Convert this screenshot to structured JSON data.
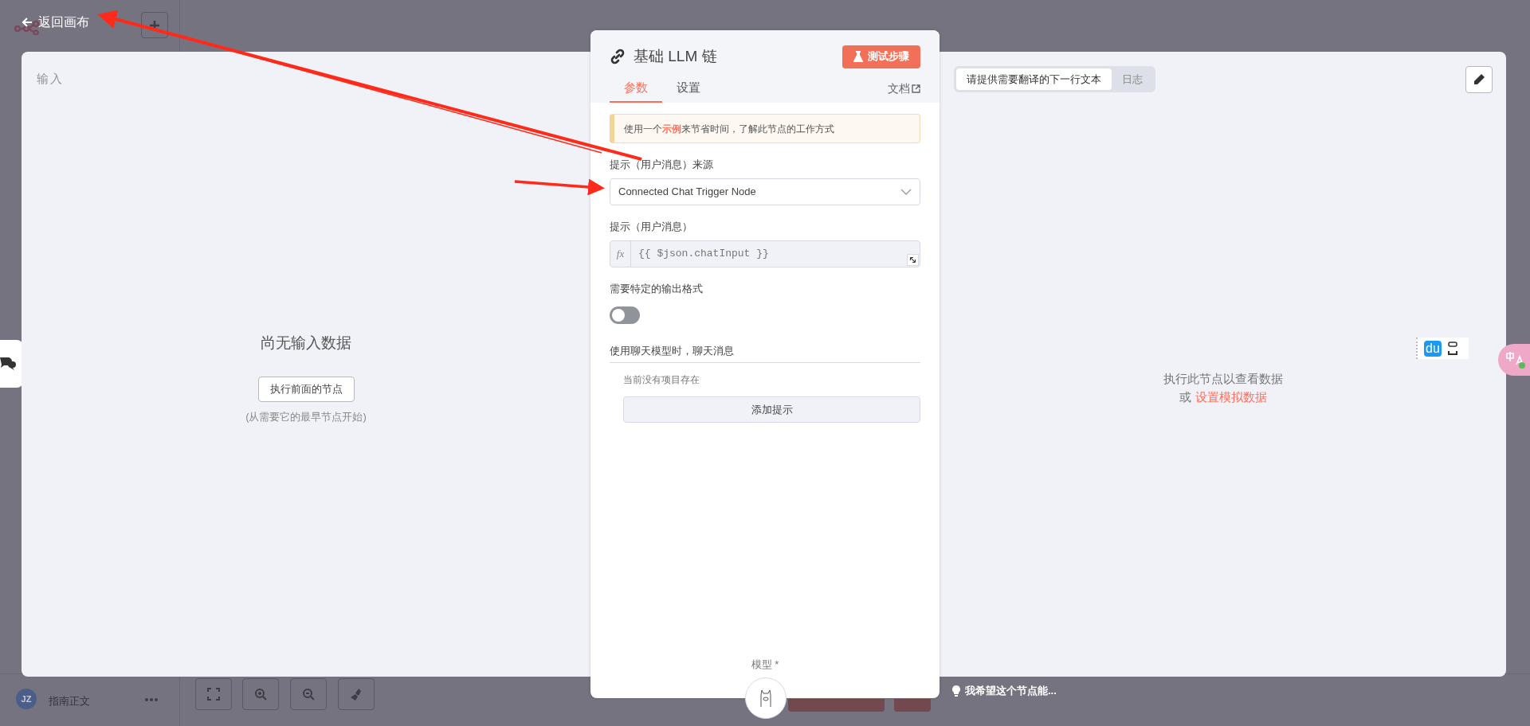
{
  "back_link": {
    "label": "返回画布"
  },
  "background_app": {
    "user": {
      "initials": "JZ",
      "name": "指南正文"
    },
    "hint": "我希望这个节点能..."
  },
  "input_panel": {
    "title": "输入",
    "empty_title": "尚无输入数据",
    "button": "执行前面的节点",
    "hint": "(从需要它的最早节点开始)"
  },
  "node_panel": {
    "title": "基础 LLM 链",
    "test_button": "测试步骤",
    "tabs": [
      {
        "label": "参数",
        "selected": true
      },
      {
        "label": "设置",
        "selected": false
      }
    ],
    "docs_link": "文档",
    "callout": "使用一个**示例**来节省时间，了解此节点的工作方式",
    "fields": [
      {
        "kind": "select",
        "label": "提示（用户消息）来源",
        "value": "Connected Chat Trigger Node"
      },
      {
        "kind": "expression",
        "label": "提示（用户消息）",
        "prefix_label": "fx",
        "value": "{{ $json.chatInput }}"
      },
      {
        "kind": "toggle",
        "label": "需要特定的输出格式",
        "on": false
      }
    ],
    "section": {
      "title": "使用聊天模型时，聊天消息",
      "empty": "当前没有项目存在",
      "add_button": "添加提示"
    },
    "model_label": "模型 *"
  },
  "output_panel": {
    "tabs": [
      {
        "label": "请提供需要翻译的下一行文本",
        "selected": true
      },
      {
        "label": "日志",
        "selected": false
      }
    ],
    "empty_line": "执行此节点以查看数据",
    "prefix": "或",
    "link": "设置模拟数据"
  },
  "translate_widget": {
    "label": "du"
  }
}
